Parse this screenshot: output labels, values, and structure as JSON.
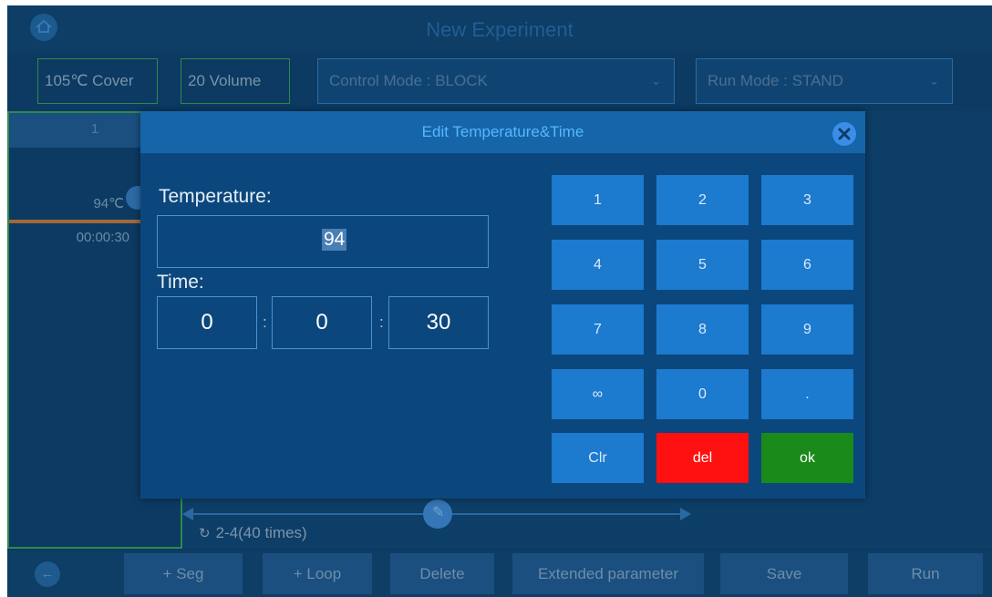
{
  "app": {
    "title": "New Experiment"
  },
  "options": {
    "cover": "105℃ Cover",
    "volume": "20 Volume",
    "control_mode": "Control Mode : BLOCK",
    "run_mode": "Run Mode  : STAND"
  },
  "segment": {
    "header": "1",
    "temperature": "94℃",
    "time": "00:00:30"
  },
  "loop": {
    "label": "2-4(40 times)"
  },
  "bottom_bar": {
    "seg": "+ Seg",
    "loop": "+ Loop",
    "delete": "Delete",
    "extended": "Extended parameter",
    "save": "Save",
    "run": "Run"
  },
  "dialog": {
    "title": "Edit Temperature&Time",
    "temperature_label": "Temperature:",
    "temperature_value": "94",
    "time_label": "Time:",
    "hours": "0",
    "minutes": "0",
    "seconds": "30",
    "separator": ":"
  },
  "keypad": {
    "k1": "1",
    "k2": "2",
    "k3": "3",
    "k4": "4",
    "k5": "5",
    "k6": "6",
    "k7": "7",
    "k8": "8",
    "k9": "9",
    "infinity": "∞",
    "k0": "0",
    "dot": ".",
    "clr": "Clr",
    "del": "del",
    "ok": "ok"
  },
  "colors": {
    "background": "#0c3a62",
    "dialog": "#0b477c",
    "dialog_header": "#1565a8",
    "key": "#1c7acf",
    "del": "#ff1010",
    "ok": "#1a8a1a",
    "option_border": "#2f8a4a"
  },
  "icons": {
    "home": "home-icon",
    "close": "close-icon",
    "back": "back-arrow-icon",
    "loop": "loop-icon",
    "dropdown": "chevron-down-icon"
  }
}
